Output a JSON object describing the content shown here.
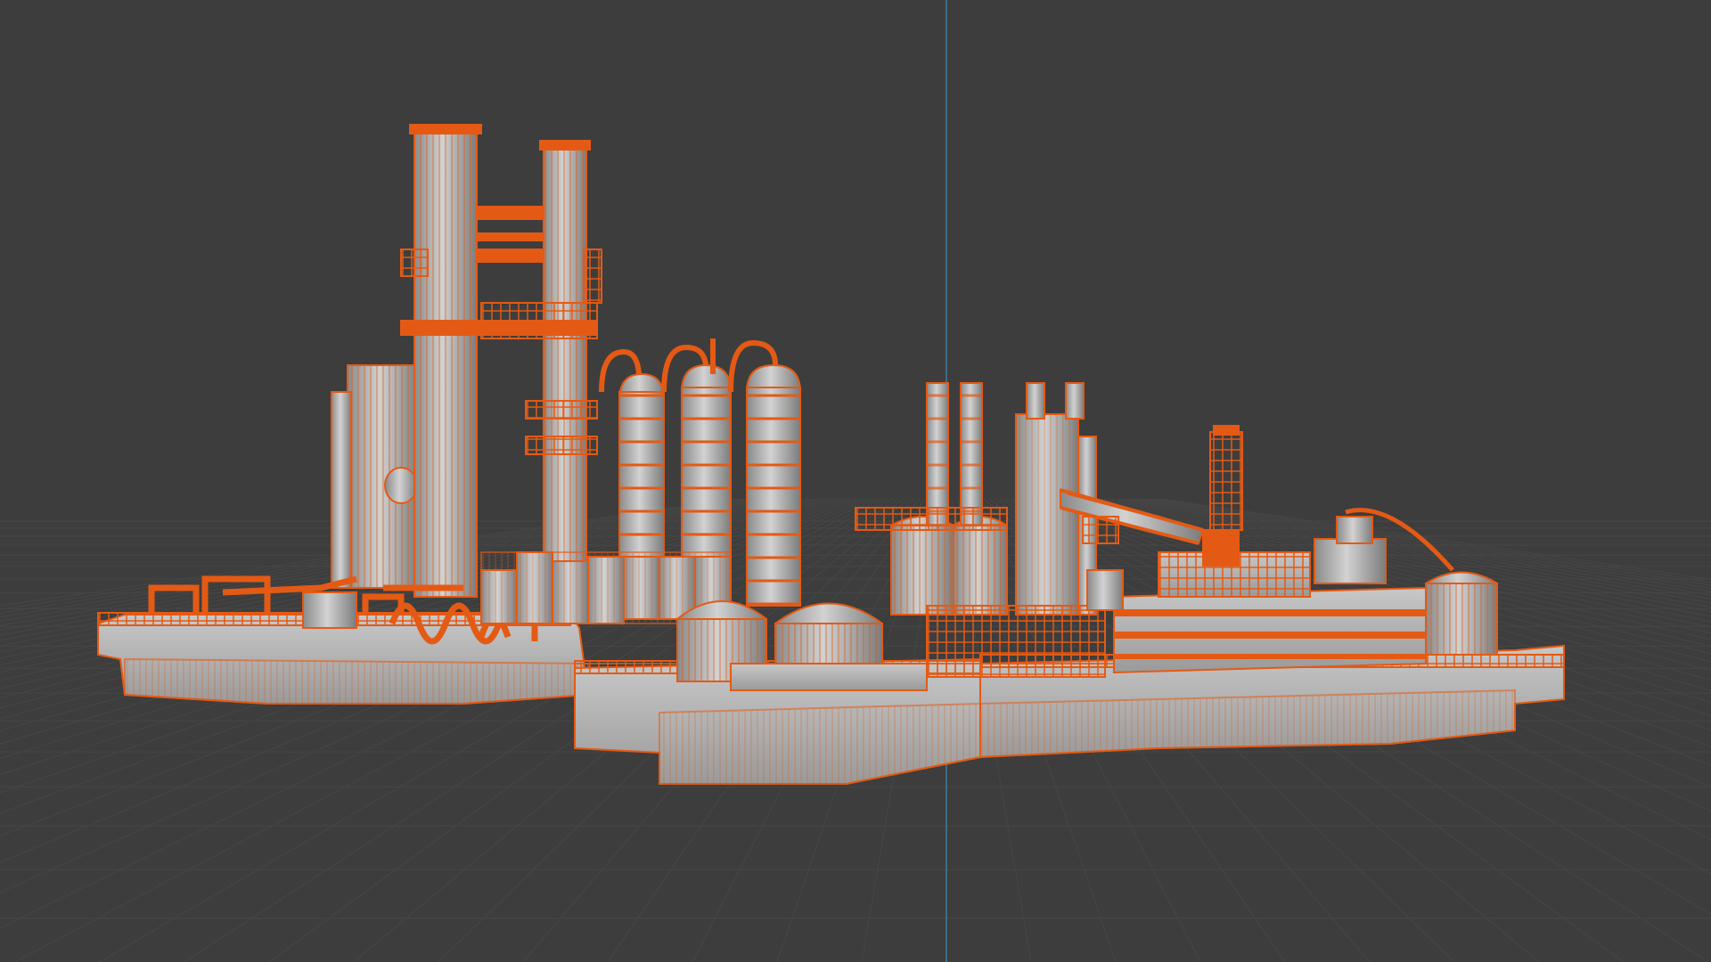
{
  "viewport": {
    "kind": "3d-viewport",
    "shading": "solid",
    "overlay": "wireframe",
    "background_color": "#3d3d3d",
    "grid_color": "#464646",
    "axis_color": "#3aa0d8",
    "selection_color": "#e45a14",
    "mesh_color": "#c4c4c4"
  },
  "scene": {
    "model": "refinery",
    "selected": true
  }
}
